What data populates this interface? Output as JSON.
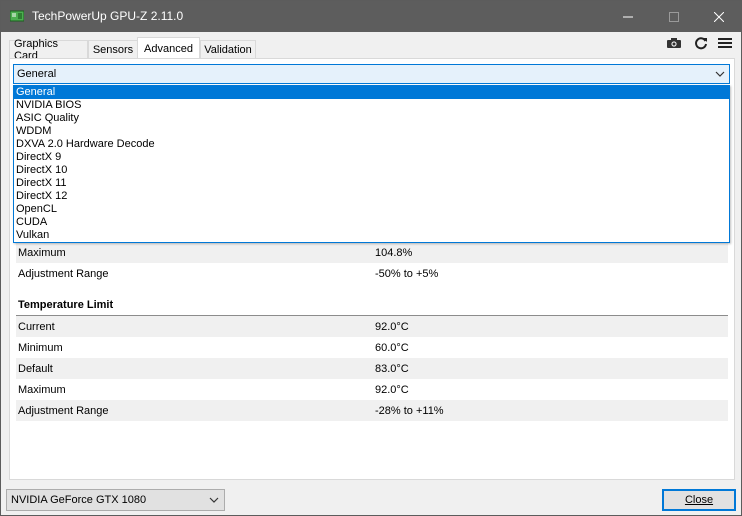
{
  "window": {
    "title": "TechPowerUp GPU-Z 2.11.0",
    "titlebar_color": "#5d5d5d"
  },
  "tabs": [
    {
      "label": "Graphics Card",
      "active": false
    },
    {
      "label": "Sensors",
      "active": false
    },
    {
      "label": "Advanced",
      "active": true
    },
    {
      "label": "Validation",
      "active": false
    }
  ],
  "toolbar_icons": [
    "camera-icon",
    "refresh-icon",
    "hamburger-menu-icon"
  ],
  "category_select": {
    "value": "General",
    "accent_color": "#0078d7",
    "options": [
      "General",
      "NVIDIA BIOS",
      "ASIC Quality",
      "WDDM",
      "DXVA 2.0 Hardware Decode",
      "DirectX 9",
      "DirectX 10",
      "DirectX 11",
      "DirectX 12",
      "OpenCL",
      "CUDA",
      "Vulkan"
    ]
  },
  "power_limit_rows": [
    {
      "label": "Maximum",
      "value": "104.8%"
    },
    {
      "label": "Adjustment Range",
      "value": "-50% to +5%"
    }
  ],
  "temperature_limit": {
    "title": "Temperature Limit",
    "rows": [
      {
        "label": "Current",
        "value": "92.0°C"
      },
      {
        "label": "Minimum",
        "value": "60.0°C"
      },
      {
        "label": "Default",
        "value": "83.0°C"
      },
      {
        "label": "Maximum",
        "value": "92.0°C"
      },
      {
        "label": "Adjustment Range",
        "value": "-28% to +11%"
      }
    ]
  },
  "footer": {
    "gpu_select_value": "NVIDIA GeForce GTX 1080",
    "close_label": "Close"
  }
}
